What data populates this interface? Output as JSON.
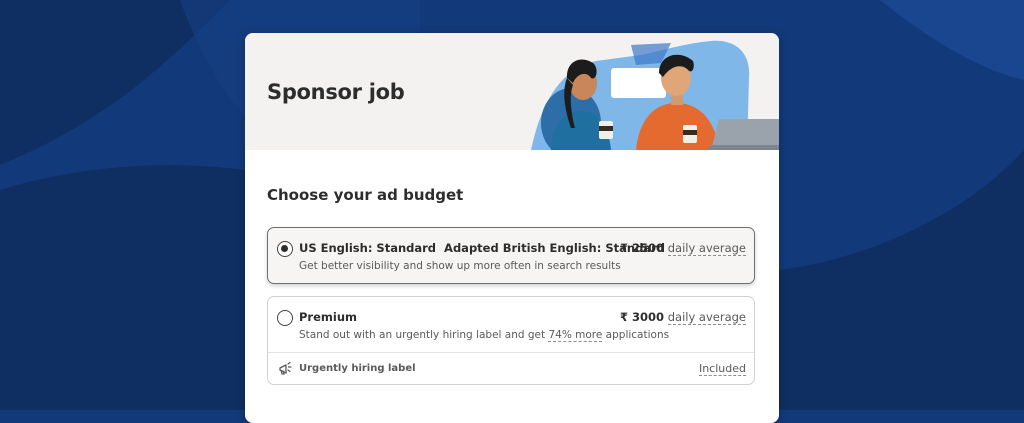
{
  "header": {
    "title": "Sponsor job"
  },
  "budget": {
    "title": "Choose your ad budget",
    "options": [
      {
        "title": "US English: Standard  Adapted British English: Standard",
        "description": "Get better visibility and show up more often in search results",
        "price": "₹ 2500",
        "price_suffix": "daily average",
        "selected": true
      },
      {
        "title": "Premium",
        "description_prefix": "Stand out with an urgently hiring label and get ",
        "description_highlight": "74% more",
        "description_suffix": " applications",
        "price": "₹ 3000",
        "price_suffix": "daily average",
        "selected": false,
        "feature": {
          "label": "Urgently hiring label",
          "value": "Included",
          "icon": "megaphone-icon"
        }
      }
    ]
  },
  "colors": {
    "background": "#123a7a",
    "card": "#ffffff",
    "header_bg": "#f3f2f1",
    "text": "#2d2d2d"
  }
}
